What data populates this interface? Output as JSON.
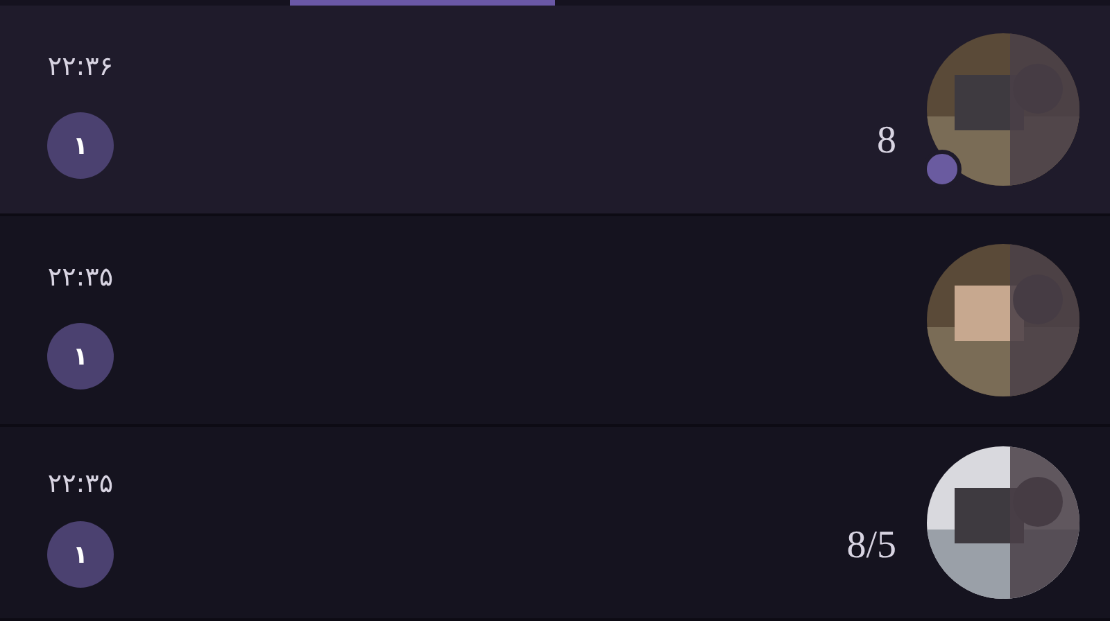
{
  "tabs": [
    {
      "selected": false
    },
    {
      "selected": true
    },
    {
      "selected": false
    },
    {
      "selected": false
    }
  ],
  "chats": [
    {
      "time": "۲۲:۳۶",
      "unread": "۱",
      "message": "8",
      "online": true,
      "selected": true
    },
    {
      "time": "۲۲:۳۵",
      "unread": "۱",
      "online": false,
      "selected": false
    },
    {
      "time": "۲۲:۳۵",
      "unread": "۱",
      "message": "8/5",
      "online": false,
      "selected": false
    }
  ]
}
